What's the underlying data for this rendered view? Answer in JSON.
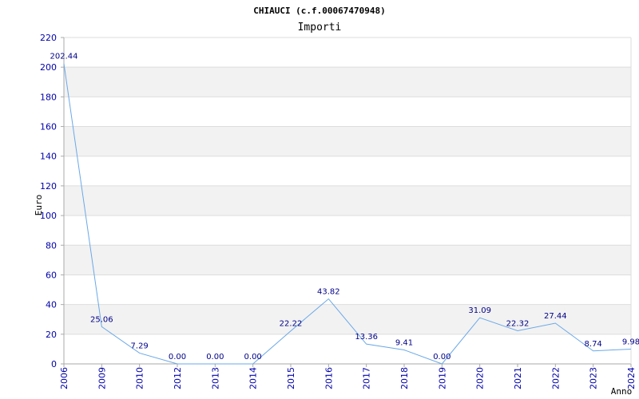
{
  "chart_data": {
    "type": "line",
    "title": "CHIAUCI (c.f.00067470948)",
    "subtitle": "Importi",
    "xlabel": "Anno",
    "ylabel": "Euro",
    "ylim": [
      0,
      220
    ],
    "yticks": [
      0,
      20,
      40,
      60,
      80,
      100,
      120,
      140,
      160,
      180,
      200,
      220
    ],
    "categories": [
      "2006",
      "2009",
      "2010",
      "2012",
      "2013",
      "2014",
      "2015",
      "2016",
      "2017",
      "2018",
      "2019",
      "2020",
      "2021",
      "2022",
      "2023",
      "2024"
    ],
    "values": [
      202.44,
      25.06,
      7.29,
      0.0,
      0.0,
      0.0,
      22.22,
      43.82,
      13.36,
      9.41,
      0.0,
      31.09,
      22.32,
      27.44,
      8.74,
      9.98
    ],
    "value_labels": [
      "202.44",
      "25.06",
      "7.29",
      "0.00",
      "0.00",
      "0.00",
      "22.22",
      "43.82",
      "13.36",
      "9.41",
      "0.00",
      "31.09",
      "22.32",
      "27.44",
      "8.74",
      "9.98"
    ],
    "grid": true,
    "colors": {
      "line": "#6aa8e8",
      "band": "#f2f2f2",
      "gridline": "#dddddd",
      "axis": "#aaaaaa",
      "tick_text": "#0000aa",
      "data_label": "#000088"
    }
  }
}
